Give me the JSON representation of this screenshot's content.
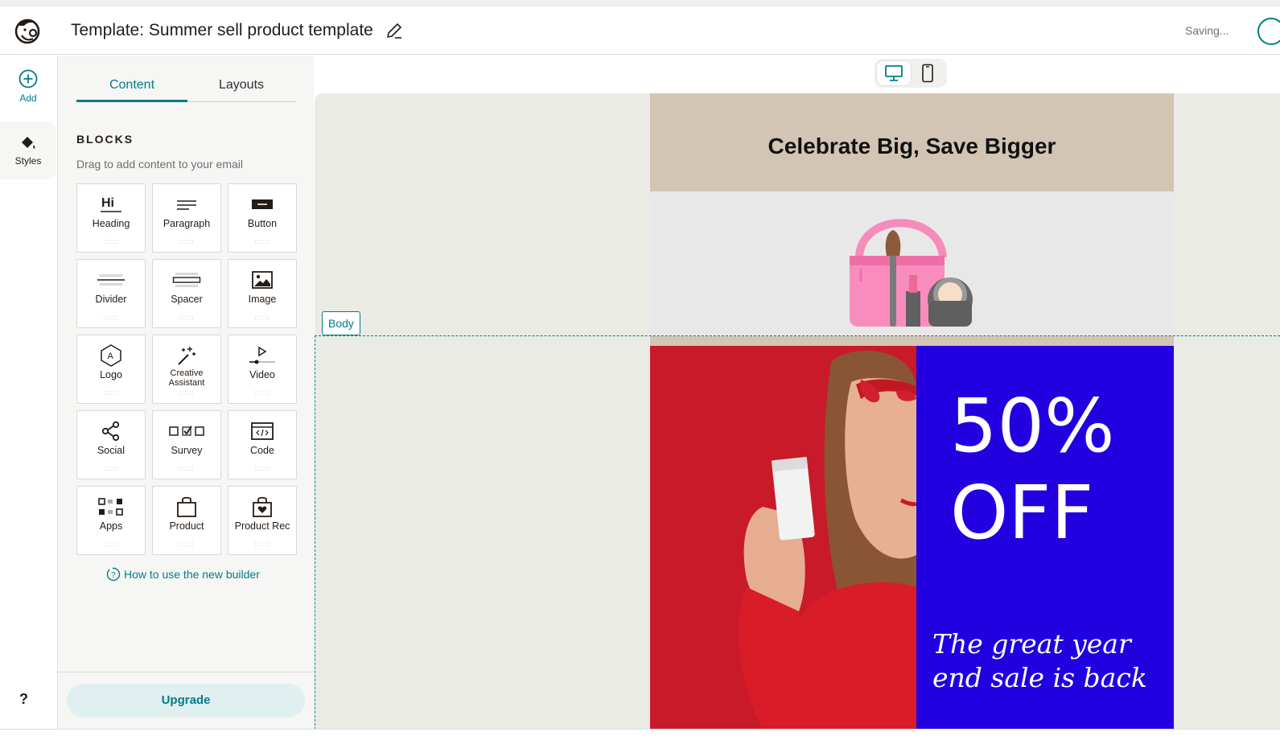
{
  "header": {
    "title": "Template: Summer sell product template",
    "status": "Saving..."
  },
  "rail": {
    "add_label": "Add",
    "styles_label": "Styles",
    "help_label": "?"
  },
  "panel": {
    "tabs": [
      {
        "label": "Content",
        "active": true
      },
      {
        "label": "Layouts",
        "active": false
      }
    ],
    "blocks_title": "BLOCKS",
    "blocks_subtitle": "Drag to add content to your email",
    "blocks": [
      {
        "label": "Heading",
        "icon": "heading-icon"
      },
      {
        "label": "Paragraph",
        "icon": "paragraph-icon"
      },
      {
        "label": "Button",
        "icon": "button-icon"
      },
      {
        "label": "Divider",
        "icon": "divider-icon"
      },
      {
        "label": "Spacer",
        "icon": "spacer-icon"
      },
      {
        "label": "Image",
        "icon": "image-icon"
      },
      {
        "label": "Logo",
        "icon": "logo-icon"
      },
      {
        "label": "Creative Assistant",
        "icon": "magic-wand-icon"
      },
      {
        "label": "Video",
        "icon": "video-icon"
      },
      {
        "label": "Social",
        "icon": "share-icon"
      },
      {
        "label": "Survey",
        "icon": "survey-icon"
      },
      {
        "label": "Code",
        "icon": "code-icon"
      },
      {
        "label": "Apps",
        "icon": "apps-icon"
      },
      {
        "label": "Product",
        "icon": "bag-icon"
      },
      {
        "label": "Product Rec",
        "icon": "bag-heart-icon"
      }
    ],
    "howto_link": "How to use the new builder",
    "upgrade_label": "Upgrade"
  },
  "canvas": {
    "body_tag": "Body",
    "email": {
      "headline": "Celebrate Big, Save Bigger",
      "promo_line1": "50%",
      "promo_line2": "OFF",
      "tagline": "The great year end sale is back"
    }
  },
  "colors": {
    "accent": "#007c89",
    "promo_blue": "#2200e0",
    "promo_red": "#c91a2a",
    "hero_beige": "#d3c5b4"
  }
}
